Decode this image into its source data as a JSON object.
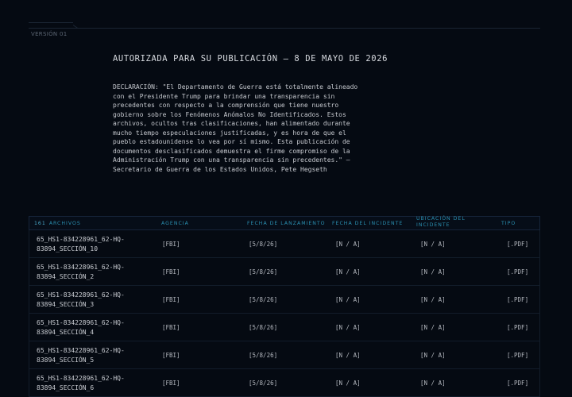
{
  "header": {
    "version": "VERSIÓN 01"
  },
  "release": {
    "title": "AUTORIZADA PARA SU PUBLICACIÓN – 8 DE MAYO DE 2026",
    "statement": "DECLARACIÓN: \"El Departamento de Guerra está totalmente alineado con el Presidente Trump para brindar una transparencia sin precedentes con respecto a la comprensión que tiene nuestro gobierno sobre los Fenómenos Anómalos No Identificados. Estos archivos, ocultos tras clasificaciones, han alimentado durante mucho tiempo especulaciones justificadas, y es hora de que el pueblo estadounidense lo vea por sí mismo. Esta publicación de documentos desclasificados demuestra el firme compromiso de la Administración Trump con una transparencia sin precedentes.\" – Secretario de Guerra de los Estados Unidos, Pete Hegseth"
  },
  "table": {
    "count": "161",
    "headers": {
      "files": "ARCHIVOS",
      "agency": "AGENCIA",
      "launch": "FECHA DE LANZAMIENTO",
      "incident": "FECHA DEL INCIDENTE",
      "location": "UBICACIÓN DEL INCIDENTE",
      "type": "TIPO"
    },
    "rows": [
      {
        "name": "65_HS1-834228961_62-HQ-83894_SECCIÓN_10",
        "agency": "[FBI]",
        "launch": "[5/8/26]",
        "incident": "[N / A]",
        "location": "[N / A]",
        "type": "[.PDF]"
      },
      {
        "name": "65_HS1-834228961_62-HQ-83894_SECCIÓN_2",
        "agency": "[FBI]",
        "launch": "[5/8/26]",
        "incident": "[N / A]",
        "location": "[N / A]",
        "type": "[.PDF]"
      },
      {
        "name": "65_HS1-834228961_62-HQ-83894_SECCIÓN_3",
        "agency": "[FBI]",
        "launch": "[5/8/26]",
        "incident": "[N / A]",
        "location": "[N / A]",
        "type": "[.PDF]"
      },
      {
        "name": "65_HS1-834228961_62-HQ-83894_SECCIÓN_4",
        "agency": "[FBI]",
        "launch": "[5/8/26]",
        "incident": "[N / A]",
        "location": "[N / A]",
        "type": "[.PDF]"
      },
      {
        "name": "65_HS1-834228961_62-HQ-83894_SECCIÓN_5",
        "agency": "[FBI]",
        "launch": "[5/8/26]",
        "incident": "[N / A]",
        "location": "[N / A]",
        "type": "[.PDF]"
      },
      {
        "name": "65_HS1-834228961_62-HQ-83894_SECCIÓN_6",
        "agency": "[FBI]",
        "launch": "[5/8/26]",
        "incident": "[N / A]",
        "location": "[N / A]",
        "type": "[.PDF]"
      }
    ]
  }
}
